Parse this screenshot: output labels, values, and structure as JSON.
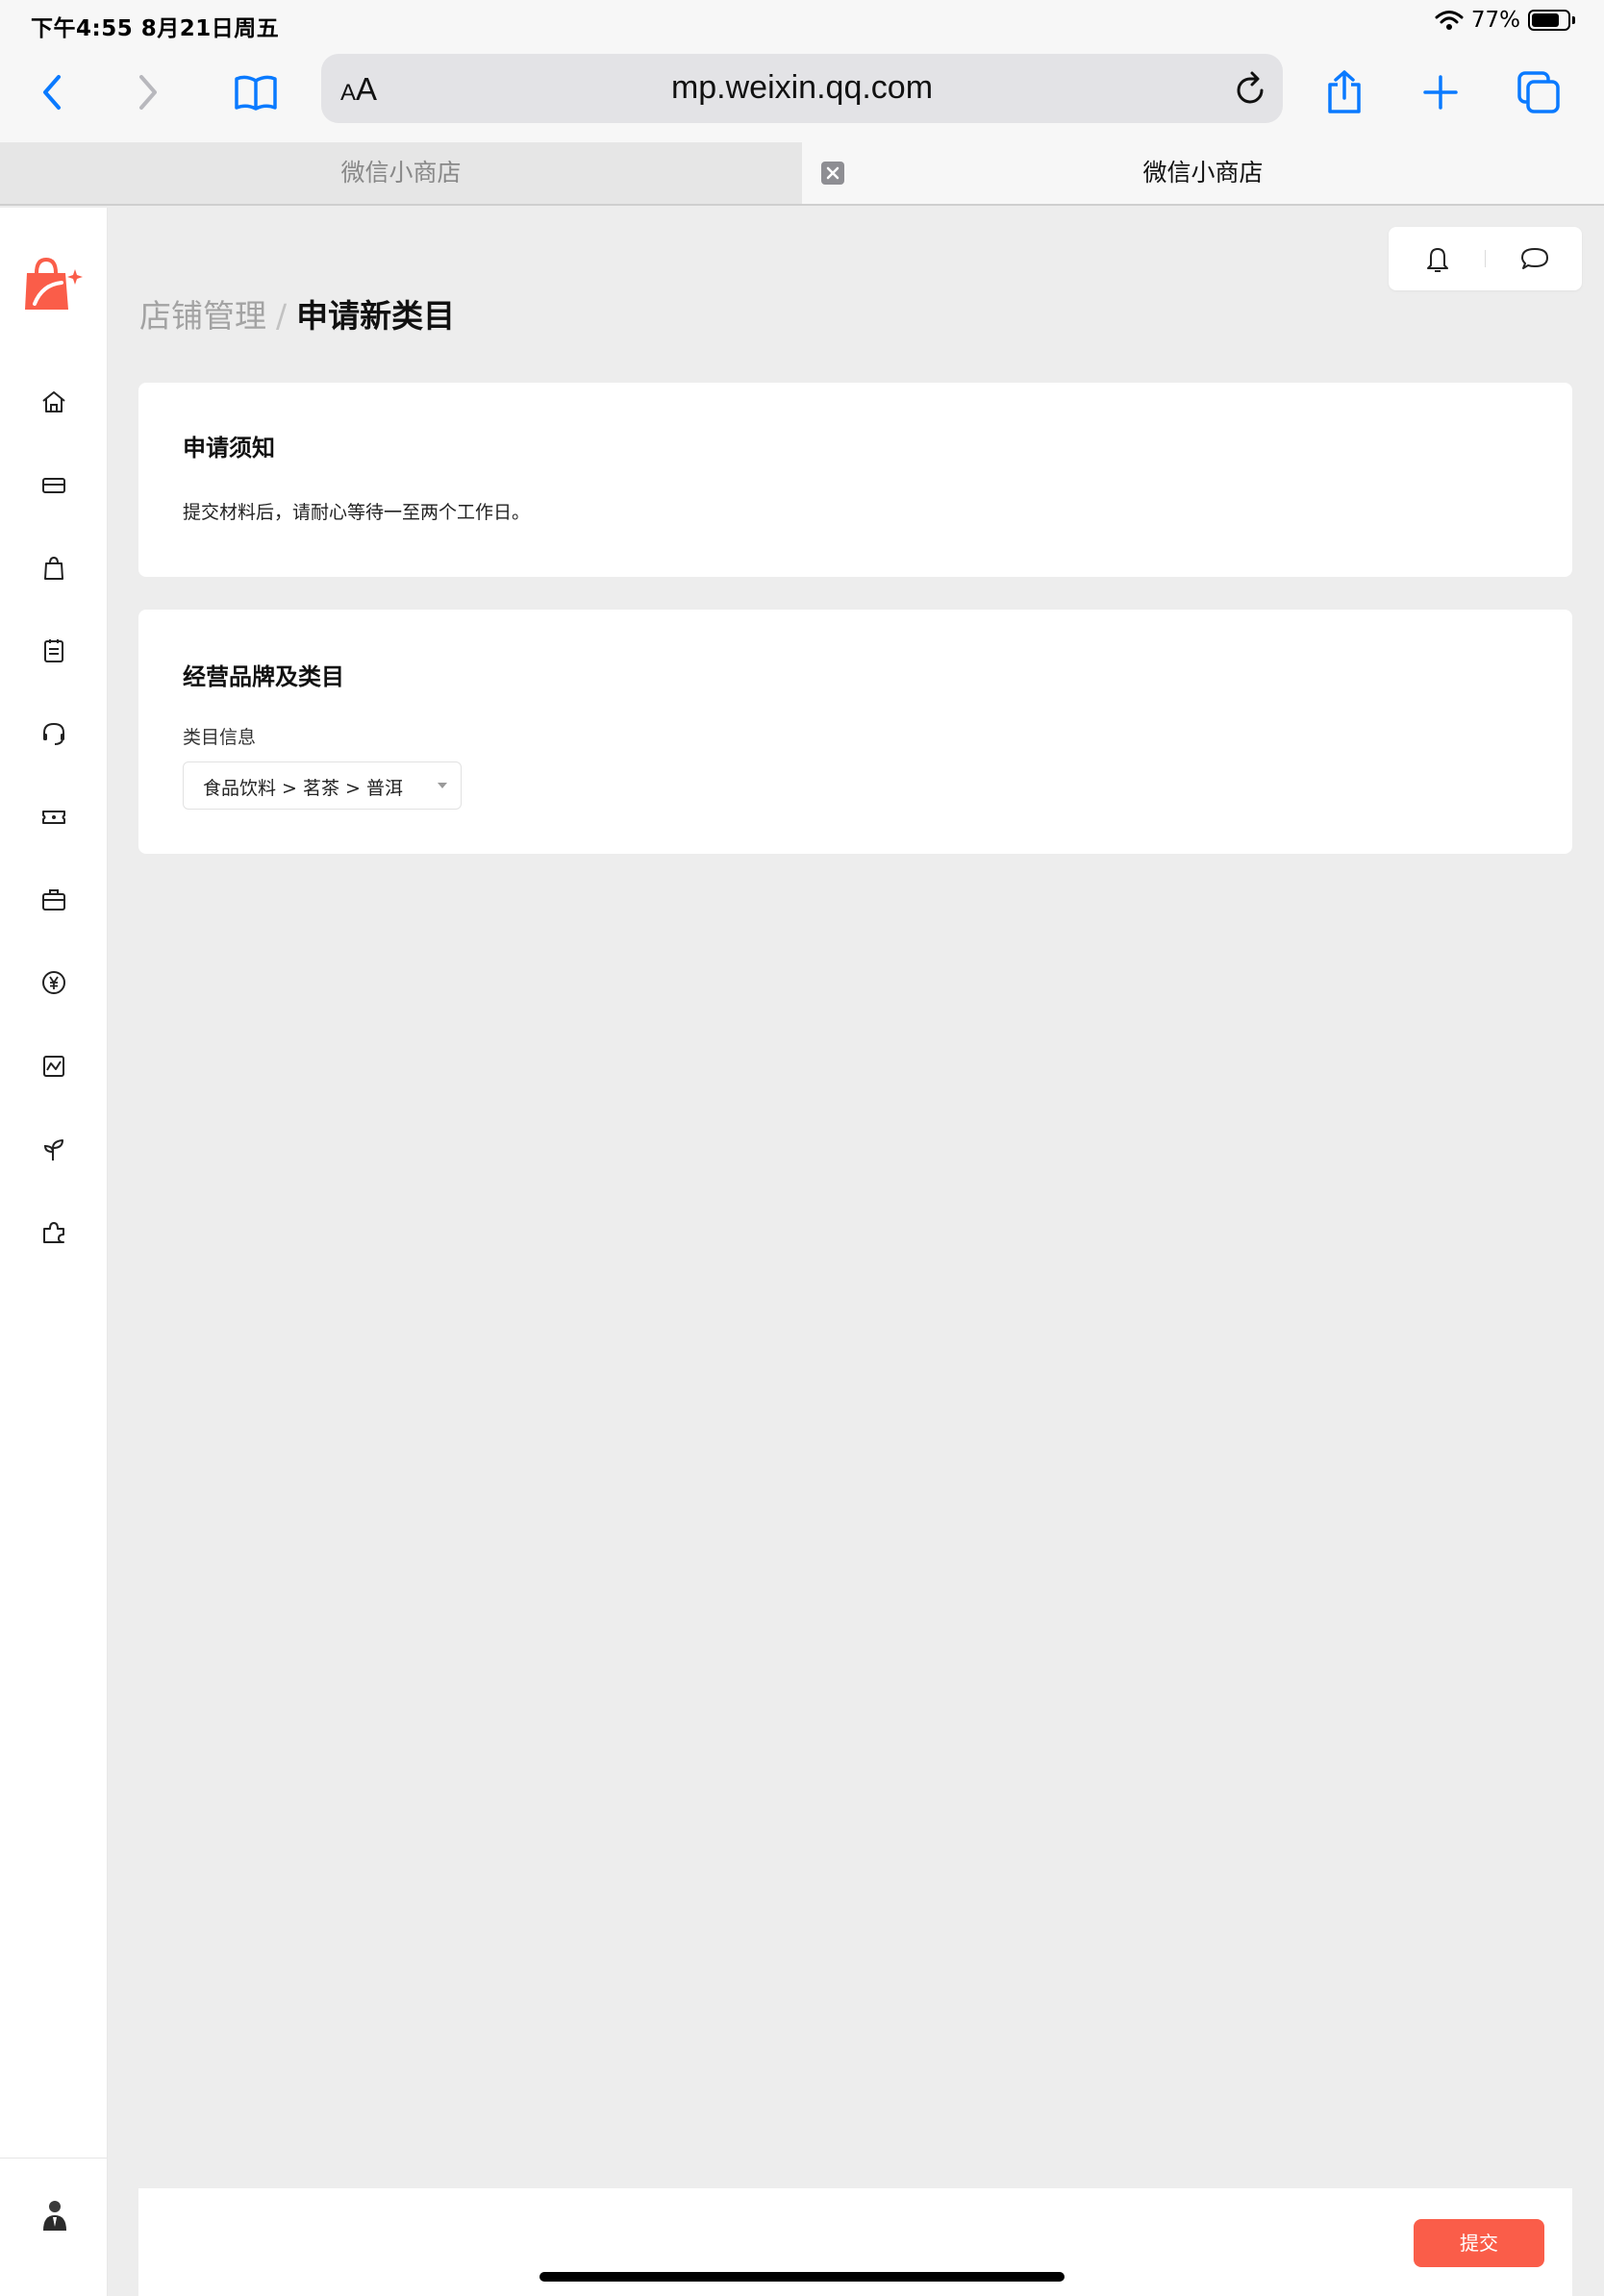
{
  "status_bar": {
    "time": "下午4:55  8月21日周五",
    "battery_text": "77%",
    "battery_level": 0.77
  },
  "browser": {
    "reader_small": "A",
    "reader_big": "A",
    "url": "mp.weixin.qq.com",
    "tabs": [
      {
        "label": "微信小商店"
      },
      {
        "label": "微信小商店"
      }
    ],
    "accent_color": "#0a7aff"
  },
  "sidebar": {
    "items": [
      {
        "icon": "home-icon"
      },
      {
        "icon": "store-icon"
      },
      {
        "icon": "shopping-bag-icon"
      },
      {
        "icon": "order-list-icon"
      },
      {
        "icon": "customer-service-icon"
      },
      {
        "icon": "coupon-icon"
      },
      {
        "icon": "briefcase-icon"
      },
      {
        "icon": "yuan-icon"
      },
      {
        "icon": "chart-icon"
      },
      {
        "icon": "sprout-icon"
      },
      {
        "icon": "plugin-icon"
      }
    ],
    "brand_color": "#fa5d49"
  },
  "breadcrumb": {
    "parent": "店铺管理",
    "separator": "/",
    "current": "申请新类目"
  },
  "notice_card": {
    "title": "申请须知",
    "text": "提交材料后，请耐心等待一至两个工作日。"
  },
  "category_card": {
    "title": "经营品牌及类目",
    "field_label": "类目信息",
    "selected_value": "食品饮料 > 茗茶 > 普洱"
  },
  "footer": {
    "submit_label": "提交"
  }
}
